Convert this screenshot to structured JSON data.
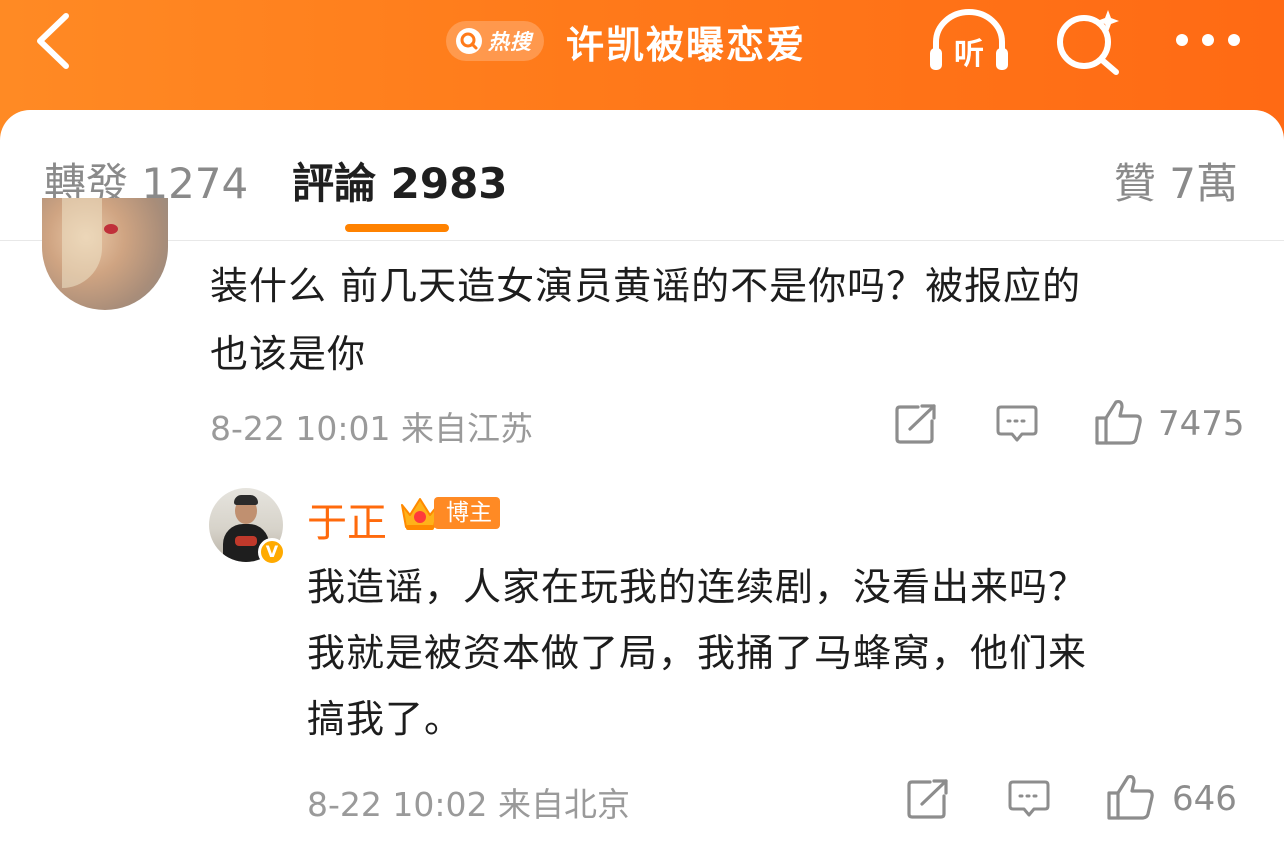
{
  "header": {
    "hot_label": "热搜",
    "topic_title": "许凯被曝恋爱",
    "listen_label": "听"
  },
  "tabs": {
    "repost": "轉發 1274",
    "comment": "評論 2983",
    "like": "贊 7萬"
  },
  "comments": [
    {
      "text_line1": "装什么 前几天造女演员黄谣的不是你吗？被报应的",
      "text_line2": "也该是你",
      "meta": "8-22 10:01 来自江苏",
      "like_count": "7475"
    },
    {
      "user_name": "于正",
      "badge": "博主",
      "verified_mark": "V",
      "text_line1": "我造谣，人家在玩我的连续剧，没看出来吗？",
      "text_line2": "我就是被资本做了局，我捅了马蜂窝，他们来",
      "text_line3": "搞我了。",
      "meta": "8-22 10:02 来自北京",
      "like_count": "646"
    }
  ],
  "colors": {
    "header_orange": "#ff7a1a",
    "accent": "#ff8200",
    "username": "#ff6a0c"
  },
  "icons": [
    "back-arrow-icon",
    "search-icon",
    "headphones-icon",
    "magnifier-sparkle-icon",
    "more-dots-icon",
    "repost-icon",
    "comment-icon",
    "thumbs-up-icon",
    "crown-icon",
    "verified-icon"
  ]
}
